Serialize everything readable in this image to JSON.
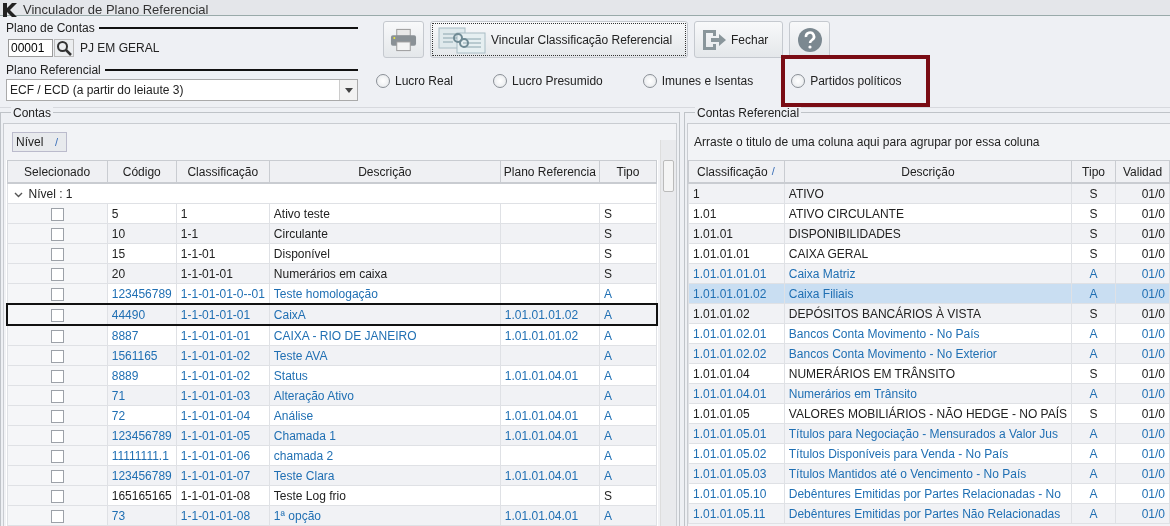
{
  "window": {
    "title": "Vinculador de Plano Referencial"
  },
  "plano_contas": {
    "label": "Plano de Contas",
    "code": "00001",
    "name": "PJ EM GERAL"
  },
  "plano_referencial": {
    "label": "Plano Referencial",
    "value": "ECF / ECD (a partir do leiaute 3)"
  },
  "toolbar": [
    {
      "kind": "print"
    },
    {
      "kind": "link",
      "label": "Vincular Classificação Referencial"
    },
    {
      "kind": "exit",
      "label": "Fechar"
    },
    {
      "kind": "help"
    }
  ],
  "regimes": [
    {
      "label": "Lucro Real",
      "selected": false,
      "highlighted": false
    },
    {
      "label": "Lucro Presumido",
      "selected": false,
      "highlighted": false
    },
    {
      "label": "Imunes e Isentas",
      "selected": false,
      "highlighted": false
    },
    {
      "label": "Partidos políticos",
      "selected": false,
      "highlighted": true
    }
  ],
  "contas": {
    "title": "Contas",
    "group_chip": "Nível",
    "group_chip_mark": "/",
    "columns": [
      "Selecionado",
      "Código",
      "Classificação",
      "Descrição",
      "Plano Referencia",
      "Tipo"
    ],
    "group_row": "Nível : 1",
    "rows": [
      {
        "checked": false,
        "kind": "synthetic",
        "selected": false,
        "cells": [
          "",
          "5",
          "1",
          "Ativo  teste",
          "",
          "S"
        ]
      },
      {
        "checked": false,
        "kind": "synthetic",
        "selected": false,
        "cells": [
          "",
          "10",
          "1-1",
          "Circulante",
          "",
          "S"
        ]
      },
      {
        "checked": false,
        "kind": "synthetic",
        "selected": false,
        "cells": [
          "",
          "15",
          "1-1-01",
          "Disponível",
          "",
          "S"
        ]
      },
      {
        "checked": false,
        "kind": "synthetic",
        "selected": false,
        "cells": [
          "",
          "20",
          "1-1-01-01",
          "Numerários em caixa",
          "",
          "S"
        ]
      },
      {
        "checked": false,
        "kind": "analytic",
        "selected": false,
        "cells": [
          "",
          "123456789",
          "1-1-01-01-0--01",
          "Teste homologação",
          "",
          "A"
        ]
      },
      {
        "checked": false,
        "kind": "analytic",
        "selected": true,
        "cells": [
          "",
          "44490",
          "1-1-01-01-01",
          "CaixA",
          "1.01.01.01.02",
          "A"
        ]
      },
      {
        "checked": false,
        "kind": "analytic",
        "selected": false,
        "cells": [
          "",
          "8887",
          "1-1-01-01-01",
          "CAIXA - RIO DE JANEIRO",
          "1.01.01.01.02",
          "A"
        ]
      },
      {
        "checked": false,
        "kind": "analytic",
        "selected": false,
        "cells": [
          "",
          "1561165",
          "1-1-01-01-02",
          "Teste AVA",
          "",
          "A"
        ]
      },
      {
        "checked": false,
        "kind": "analytic",
        "selected": false,
        "cells": [
          "",
          "8889",
          "1-1-01-01-02",
          "Status",
          "1.01.01.04.01",
          "A"
        ]
      },
      {
        "checked": false,
        "kind": "analytic",
        "selected": false,
        "cells": [
          "",
          "71",
          "1-1-01-01-03",
          "Alteração Ativo",
          "",
          "A"
        ]
      },
      {
        "checked": false,
        "kind": "analytic",
        "selected": false,
        "cells": [
          "",
          "72",
          "1-1-01-01-04",
          "Análise",
          "1.01.01.04.01",
          "A"
        ]
      },
      {
        "checked": false,
        "kind": "analytic",
        "selected": false,
        "cells": [
          "",
          "123456789",
          "1-1-01-01-05",
          "Chamada 1",
          "1.01.01.04.01",
          "A"
        ]
      },
      {
        "checked": false,
        "kind": "analytic",
        "selected": false,
        "cells": [
          "",
          "11111111.1",
          "1-1-01-01-06",
          "chamada 2",
          "",
          "A"
        ]
      },
      {
        "checked": false,
        "kind": "analytic",
        "selected": false,
        "cells": [
          "",
          "123456789",
          "1-1-01-01-07",
          "Teste Clara",
          "1.01.01.04.01",
          "A"
        ]
      },
      {
        "checked": false,
        "kind": "synthetic",
        "selected": false,
        "cells": [
          "",
          "165165165",
          "1-1-01-01-08",
          "Teste Log frio",
          "",
          "S"
        ]
      },
      {
        "checked": false,
        "kind": "analytic",
        "selected": false,
        "cells": [
          "",
          "73",
          "1-1-01-01-08",
          "1ª opção",
          "1.01.01.04.01",
          "A"
        ]
      }
    ]
  },
  "contas_referencial": {
    "title": "Contas Referencial",
    "group_hint": "Arraste o titulo de uma coluna aqui para agrupar por essa coluna",
    "columns": [
      "Classificação",
      "Descrição",
      "Tipo",
      "Validad"
    ],
    "sort_mark": "/",
    "rows": [
      {
        "kind": "synthetic",
        "selected": false,
        "cells": [
          "1",
          "ATIVO",
          "S",
          "01/0"
        ]
      },
      {
        "kind": "synthetic",
        "selected": false,
        "cells": [
          "1.01",
          "ATIVO CIRCULANTE",
          "S",
          "01/0"
        ]
      },
      {
        "kind": "synthetic",
        "selected": false,
        "cells": [
          "1.01.01",
          "DISPONIBILIDADES",
          "S",
          "01/0"
        ]
      },
      {
        "kind": "synthetic",
        "selected": false,
        "cells": [
          "1.01.01.01",
          "CAIXA GERAL",
          "S",
          "01/0"
        ]
      },
      {
        "kind": "analytic",
        "selected": false,
        "cells": [
          "1.01.01.01.01",
          "Caixa Matriz",
          "A",
          "01/0"
        ]
      },
      {
        "kind": "analytic",
        "selected": true,
        "cells": [
          "1.01.01.01.02",
          "Caixa Filiais",
          "A",
          "01/0"
        ]
      },
      {
        "kind": "synthetic",
        "selected": false,
        "cells": [
          "1.01.01.02",
          "DEPÓSITOS BANCÁRIOS À VISTA",
          "S",
          "01/0"
        ]
      },
      {
        "kind": "analytic",
        "selected": false,
        "cells": [
          "1.01.01.02.01",
          "Bancos Conta Movimento - No País",
          "A",
          "01/0"
        ]
      },
      {
        "kind": "analytic",
        "selected": false,
        "cells": [
          "1.01.01.02.02",
          "Bancos Conta Movimento - No Exterior",
          "A",
          "01/0"
        ]
      },
      {
        "kind": "synthetic",
        "selected": false,
        "cells": [
          "1.01.01.04",
          "NUMERÁRIOS EM TRÂNSITO",
          "S",
          "01/0"
        ]
      },
      {
        "kind": "analytic",
        "selected": false,
        "cells": [
          "1.01.01.04.01",
          "Numerários em Trânsito",
          "A",
          "01/0"
        ]
      },
      {
        "kind": "synthetic",
        "selected": false,
        "cells": [
          "1.01.01.05",
          "VALORES MOBILIÁRIOS - NÃO HEDGE - NO PAÍS",
          "S",
          "01/0"
        ]
      },
      {
        "kind": "analytic",
        "selected": false,
        "cells": [
          "1.01.01.05.01",
          "Títulos para Negociação - Mensurados a Valor Jus",
          "A",
          "01/0"
        ]
      },
      {
        "kind": "analytic",
        "selected": false,
        "cells": [
          "1.01.01.05.02",
          "Títulos Disponíveis para Venda - No País",
          "A",
          "01/0"
        ]
      },
      {
        "kind": "analytic",
        "selected": false,
        "cells": [
          "1.01.01.05.03",
          "Títulos Mantidos até o Vencimento - No País",
          "A",
          "01/0"
        ]
      },
      {
        "kind": "analytic",
        "selected": false,
        "cells": [
          "1.01.01.05.10",
          "Debêntures Emitidas por Partes Relacionadas - No",
          "A",
          "01/0"
        ]
      },
      {
        "kind": "analytic",
        "selected": false,
        "cells": [
          "1.01.01.05.11",
          "Debêntures Emitidas por Partes Não Relacionadas",
          "A",
          "01/0"
        ]
      }
    ]
  }
}
